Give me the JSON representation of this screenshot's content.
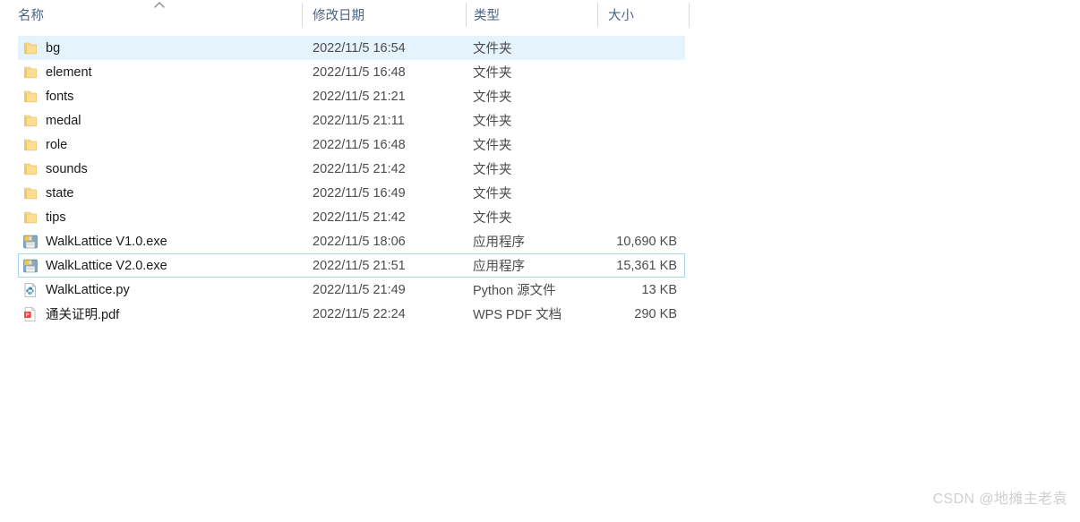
{
  "header": {
    "sort_indicator": "sort-ascending-caret",
    "columns": [
      {
        "label": "名称",
        "name": "name"
      },
      {
        "label": "修改日期",
        "name": "date-modified"
      },
      {
        "label": "类型",
        "name": "type"
      },
      {
        "label": "大小",
        "name": "size"
      }
    ]
  },
  "rows": [
    {
      "name": "bg",
      "date": "2022/11/5 16:54",
      "type": "文件夹",
      "size": "",
      "icon": "folder-icon",
      "state": "selected"
    },
    {
      "name": "element",
      "date": "2022/11/5 16:48",
      "type": "文件夹",
      "size": "",
      "icon": "folder-icon",
      "state": ""
    },
    {
      "name": "fonts",
      "date": "2022/11/5 21:21",
      "type": "文件夹",
      "size": "",
      "icon": "folder-icon",
      "state": ""
    },
    {
      "name": "medal",
      "date": "2022/11/5 21:11",
      "type": "文件夹",
      "size": "",
      "icon": "folder-icon",
      "state": ""
    },
    {
      "name": "role",
      "date": "2022/11/5 16:48",
      "type": "文件夹",
      "size": "",
      "icon": "folder-icon",
      "state": ""
    },
    {
      "name": "sounds",
      "date": "2022/11/5 21:42",
      "type": "文件夹",
      "size": "",
      "icon": "folder-icon",
      "state": ""
    },
    {
      "name": "state",
      "date": "2022/11/5 16:49",
      "type": "文件夹",
      "size": "",
      "icon": "folder-icon",
      "state": ""
    },
    {
      "name": "tips",
      "date": "2022/11/5 21:42",
      "type": "文件夹",
      "size": "",
      "icon": "folder-icon",
      "state": ""
    },
    {
      "name": "WalkLattice V1.0.exe",
      "date": "2022/11/5 18:06",
      "type": "应用程序",
      "size": "10,690 KB",
      "icon": "application-exe-icon",
      "state": ""
    },
    {
      "name": "WalkLattice V2.0.exe",
      "date": "2022/11/5 21:51",
      "type": "应用程序",
      "size": "15,361 KB",
      "icon": "application-exe-icon",
      "state": "focused"
    },
    {
      "name": "WalkLattice.py",
      "date": "2022/11/5 21:49",
      "type": "Python 源文件",
      "size": "13 KB",
      "icon": "python-file-icon",
      "state": ""
    },
    {
      "name": "通关证明.pdf",
      "date": "2022/11/5 22:24",
      "type": "WPS PDF 文档",
      "size": "290 KB",
      "icon": "pdf-file-icon",
      "state": ""
    }
  ],
  "watermark": {
    "text": "CSDN @地摊主老袁"
  },
  "colors": {
    "selection_fill": "#e5f3fd",
    "focus_border": "#a9d3f2",
    "header_text": "#4a6484",
    "body_text": "#1a1a1a",
    "secondary_text": "#4c4c4c",
    "folder_yellow": "#fcd77a",
    "watermark_gray": "#cfcfcf"
  }
}
